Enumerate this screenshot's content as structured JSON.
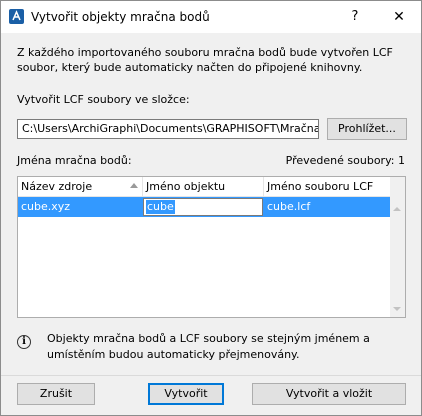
{
  "window": {
    "title": "Vytvořit objekty mračna bodů",
    "app_icon": "archicad-icon",
    "help_label": "?",
    "close_label": "✕"
  },
  "description": "Z každého importovaného souboru mračna bodů bude vytvořen LCF soubor, který bude automaticky načten do připojené knihovny.",
  "folder": {
    "label": "Vytvořit LCF soubory ve složce:",
    "path": "C:\\Users\\ArchiGraphi\\Documents\\GRAPHISOFT\\Mračna bo",
    "browse_label": "Prohlížet..."
  },
  "table": {
    "names_label": "Jména mračna bodů:",
    "converted_label": "Převedené soubory: 1",
    "columns": [
      "Název zdroje",
      "Jméno objektu",
      "Jméno souboru LCF"
    ],
    "rows": [
      {
        "source": "cube.xyz",
        "object": "cube",
        "lcf": "cube.lcf"
      }
    ]
  },
  "info": {
    "icon": "info-icon",
    "text": "Objekty mračna bodů a LCF soubory se stejným jménem a umístěním budou automaticky přejmenovány."
  },
  "buttons": {
    "cancel": "Zrušit",
    "create": "Vytvořit",
    "create_and_place": "Vytvořit a vložit"
  },
  "colors": {
    "selection": "#3399ff",
    "default_button_border": "#0078d7"
  }
}
